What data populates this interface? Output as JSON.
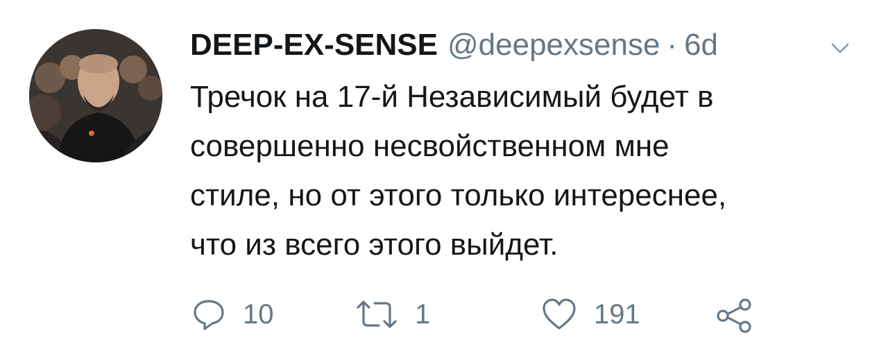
{
  "tweet": {
    "display_name": "DEEP-EX-SENSE",
    "handle": "@deepexsense",
    "separator": "·",
    "time": "6d",
    "text_lines": [
      "Тречок на 17-й Независимый будет в",
      "совершенно несвойственном мне",
      "стиле, но от этого только интереснее,",
      "что из всего этого выйдет."
    ]
  },
  "actions": {
    "reply_count": "10",
    "retweet_count": "1",
    "like_count": "191"
  },
  "icons": {
    "reply": "reply-icon",
    "retweet": "retweet-icon",
    "like": "heart-icon",
    "share": "share-icon",
    "menu": "chevron-down-icon"
  },
  "colors": {
    "text": "#14171a",
    "secondary": "#657786"
  }
}
